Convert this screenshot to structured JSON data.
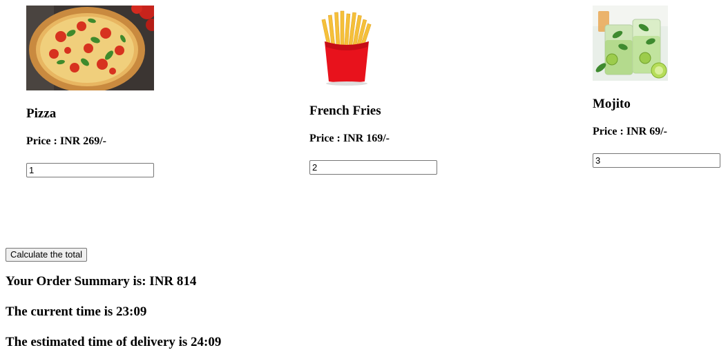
{
  "items": [
    {
      "name": "Pizza",
      "price": "Price : INR 269/-",
      "qty": "1"
    },
    {
      "name": "French Fries",
      "price": "Price : INR 169/-",
      "qty": "2"
    },
    {
      "name": "Mojito",
      "price": "Price : INR 69/-",
      "qty": "3"
    }
  ],
  "calc_button": "Calculate the total",
  "summary": {
    "order": "Your Order Summary is: INR 814",
    "current_time": "The current time is 23:09",
    "delivery_time": "The estimated time of delivery is 24:09"
  }
}
